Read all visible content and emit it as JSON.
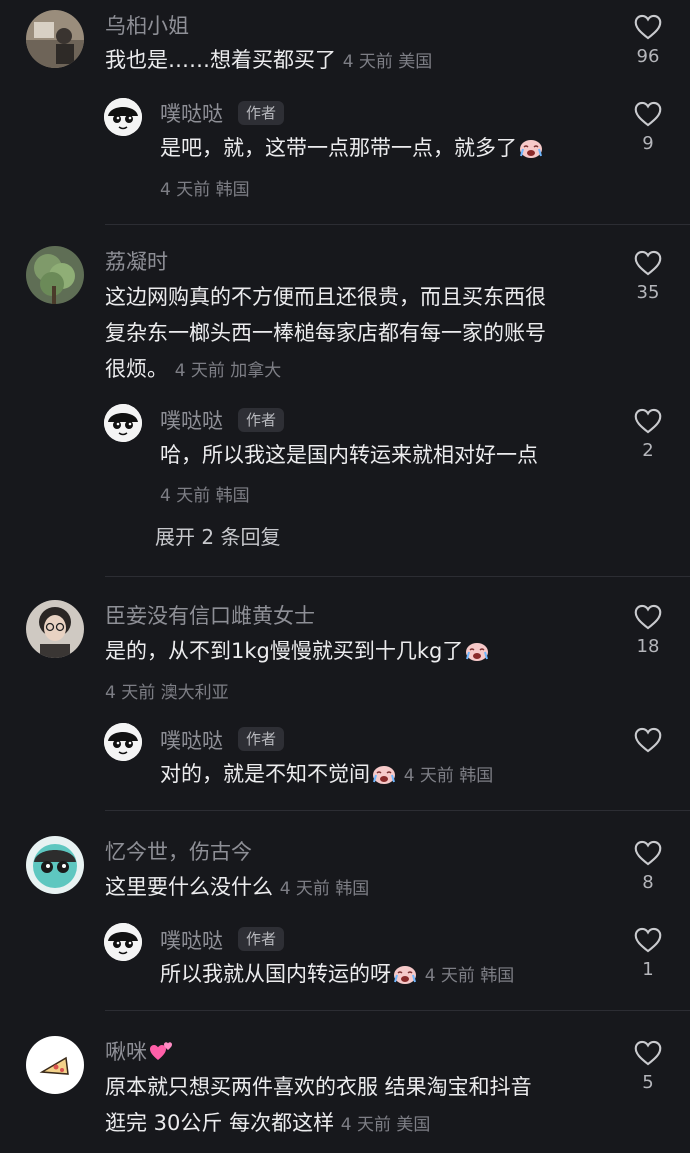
{
  "comments": [
    {
      "user": "乌桕小姐",
      "text_lines": [
        "我也是……想着买都买了"
      ],
      "meta": "4 天前 美国",
      "likes": "96",
      "avatar": "photo-avatar-desk",
      "reply": {
        "user": "噗哒哒",
        "badge": "作者",
        "text_lines": [
          "是吧，就，这带一点那带一点，就多了"
        ],
        "meta": "4 天前 韩国",
        "likes": "9"
      }
    },
    {
      "user": "荔凝时",
      "text_lines": [
        "这边网购真的不方便而且还很贵，而且买东西很",
        "复杂东一榔头西一棒槌每家店都有每一家的账号",
        "很烦。"
      ],
      "meta": "4 天前 加拿大",
      "likes": "35",
      "avatar": "photo-avatar-plant",
      "reply": {
        "user": "噗哒哒",
        "badge": "作者",
        "text_lines": [
          "哈，所以我这是国内转运来就相对好一点"
        ],
        "meta": "4 天前 韩国",
        "likes": "2"
      },
      "expand": "展开 2 条回复"
    },
    {
      "user": "臣妾没有信口雌黄女士",
      "text_lines": [
        "是的，从不到1kg慢慢就买到十几kg了"
      ],
      "meta": "4 天前 澳大利亚",
      "likes": "18",
      "avatar": "photo-avatar-woman",
      "reply": {
        "user": "噗哒哒",
        "badge": "作者",
        "text_lines": [
          "对的，就是不知不觉间"
        ],
        "meta": "4 天前 韩国",
        "likes": ""
      }
    },
    {
      "user": "忆今世，伤古今",
      "text_lines": [
        "这里要什么没什么"
      ],
      "meta": "4 天前 韩国",
      "likes": "8",
      "avatar": "cartoon-avatar",
      "reply": {
        "user": "噗哒哒",
        "badge": "作者",
        "text_lines": [
          "所以我就从国内转运的呀"
        ],
        "meta": "4 天前 韩国",
        "likes": "1"
      }
    },
    {
      "user": "啾咪",
      "text_lines": [
        "原本就只想买两件喜欢的衣服   结果淘宝和抖音",
        "逛完 30公斤 每次都这样"
      ],
      "meta": "4 天前 美国",
      "likes": "5",
      "avatar": "pizza-avatar"
    }
  ],
  "colors": {
    "background": "#17181c",
    "secondary_text": "#8e8f96",
    "primary_text": "#ececee"
  },
  "icons": {
    "like": "heart-outline-icon",
    "cry": "crying-emoji-icon",
    "heart_emoji": "pink-hearts-emoji-icon"
  }
}
